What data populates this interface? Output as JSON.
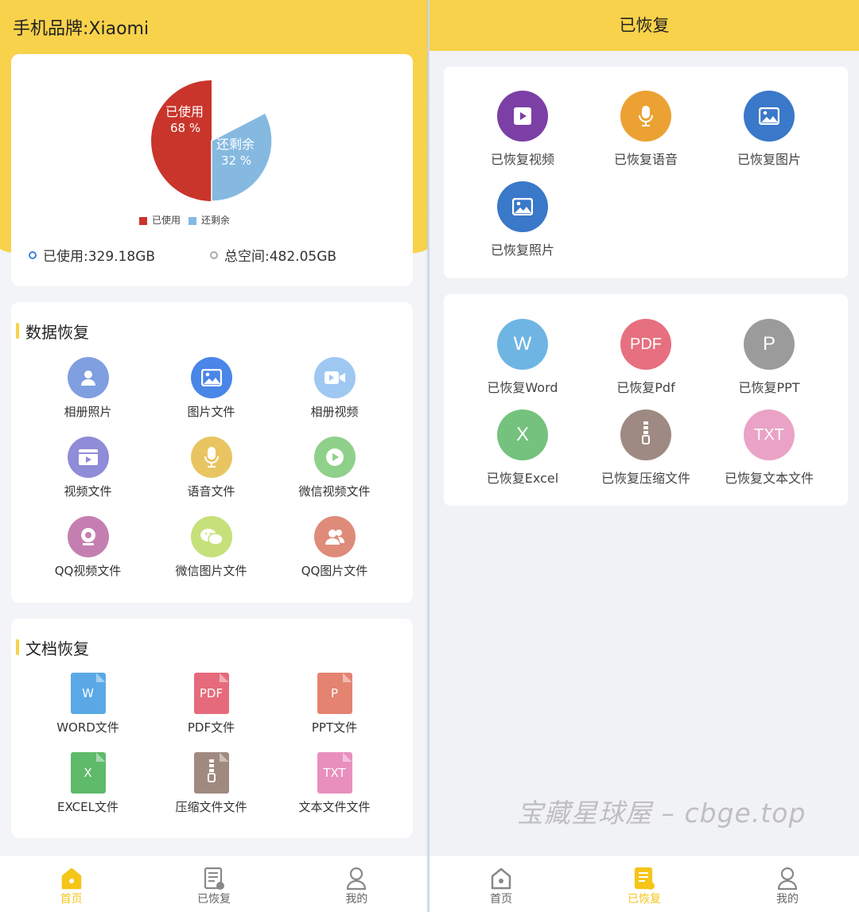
{
  "left": {
    "brand": "手机品牌:Xiaomi",
    "pie": {
      "used_label": "已使用",
      "used_pct": "68 %",
      "free_label": "还剩余",
      "free_pct": "32 %",
      "legend_used": "已使用",
      "legend_free": "还剩余",
      "used_color": "#c9352b",
      "free_color": "#85b9e0"
    },
    "used_space": "已使用:329.18GB",
    "total_space": "总空间:482.05GB",
    "data_recovery": {
      "title": "数据恢复",
      "items": [
        {
          "label": "相册照片",
          "icon": "person-photo-icon",
          "color": "#7f9fe0"
        },
        {
          "label": "图片文件",
          "icon": "image-icon",
          "color": "#4a86e8"
        },
        {
          "label": "相册视频",
          "icon": "video-camera-icon",
          "color": "#9ec8f2"
        },
        {
          "label": "视频文件",
          "icon": "film-icon",
          "color": "#8f8cd8"
        },
        {
          "label": "语音文件",
          "icon": "microphone-icon",
          "color": "#e9c562"
        },
        {
          "label": "微信视频文件",
          "icon": "play-icon",
          "color": "#8fd08a"
        },
        {
          "label": "QQ视频文件",
          "icon": "webcam-icon",
          "color": "#c47fb0"
        },
        {
          "label": "微信图片文件",
          "icon": "wechat-icon",
          "color": "#c6e07a"
        },
        {
          "label": "QQ图片文件",
          "icon": "users-icon",
          "color": "#df8b7a"
        }
      ]
    },
    "doc_recovery": {
      "title": "文档恢复",
      "items": [
        {
          "label": "WORD文件",
          "letter": "W",
          "icon": "word-file-icon",
          "color": "#5aa9e6"
        },
        {
          "label": "PDF文件",
          "letter": "PDF",
          "icon": "pdf-file-icon",
          "color": "#e56b7c"
        },
        {
          "label": "PPT文件",
          "letter": "P",
          "icon": "ppt-file-icon",
          "color": "#e48370"
        },
        {
          "label": "EXCEL文件",
          "letter": "X",
          "icon": "excel-file-icon",
          "color": "#5fba6a"
        },
        {
          "label": "压缩文件文件",
          "letter": "",
          "icon": "zip-file-icon",
          "color": "#a08a7f"
        },
        {
          "label": "文本文件文件",
          "letter": "TXT",
          "icon": "txt-file-icon",
          "color": "#e98fbe"
        }
      ]
    },
    "nav": [
      {
        "label": "首页",
        "icon": "home-icon",
        "active": true
      },
      {
        "label": "已恢复",
        "icon": "recovered-icon",
        "active": false
      },
      {
        "label": "我的",
        "icon": "user-icon",
        "active": false
      }
    ]
  },
  "right": {
    "title": "已恢复",
    "media": [
      {
        "label": "已恢复视频",
        "icon": "play-icon",
        "color": "#7b3fa6"
      },
      {
        "label": "已恢复语音",
        "icon": "microphone-icon",
        "color": "#eba233"
      },
      {
        "label": "已恢复图片",
        "icon": "image-icon",
        "color": "#3a78c9"
      },
      {
        "label": "已恢复照片",
        "icon": "image-icon",
        "color": "#3a78c9"
      }
    ],
    "docs": [
      {
        "label": "已恢复Word",
        "letter": "W",
        "icon": "word-icon",
        "color": "#6fb5e3"
      },
      {
        "label": "已恢复Pdf",
        "letter": "PDF",
        "icon": "pdf-icon",
        "color": "#e6707f"
      },
      {
        "label": "已恢复PPT",
        "letter": "P",
        "icon": "ppt-icon",
        "color": "#9b9b9b"
      },
      {
        "label": "已恢复Excel",
        "letter": "X",
        "icon": "excel-icon",
        "color": "#74c27d"
      },
      {
        "label": "已恢复压缩文件",
        "letter": "",
        "icon": "zip-icon",
        "color": "#9e8a82"
      },
      {
        "label": "已恢复文本文件",
        "letter": "TXT",
        "icon": "txt-icon",
        "color": "#eaa3c6"
      }
    ],
    "watermark": "宝藏星球屋 – cbge.top",
    "nav": [
      {
        "label": "首页",
        "icon": "home-icon",
        "active": false
      },
      {
        "label": "已恢复",
        "icon": "recovered-icon",
        "active": true
      },
      {
        "label": "我的",
        "icon": "user-icon",
        "active": false
      }
    ]
  }
}
